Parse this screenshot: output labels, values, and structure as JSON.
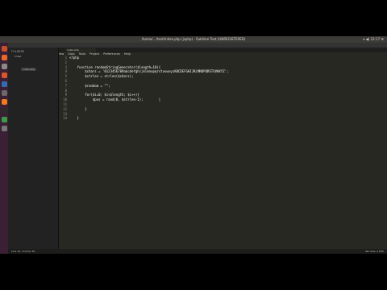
{
  "window": {
    "title": "/home/…/test/index.php (jsphp) - Sublime Text (UNREGISTERED)"
  },
  "tray": {
    "text": "▾ ◀) 12:17 ⚙"
  },
  "menu": [
    "File",
    "Edit",
    "Selection",
    "Find",
    "View",
    "Goto",
    "Tools",
    "Project",
    "Preferences",
    "Help"
  ],
  "sidebar": {
    "header": "FOLDERS",
    "folder": "▾ test",
    "file": "index.php"
  },
  "tab": {
    "label": "index.php"
  },
  "code_lines": [
    {
      "n": "1",
      "text": "<?php"
    },
    {
      "n": "2",
      "text": ""
    },
    {
      "n": "3",
      "text": "    function randomStringGenerator($length=10){"
    },
    {
      "n": "4",
      "text": "        $chars = '0123456789abcdefghijklmnopqrstuvwxyzABCDEFGHIJKLMNOPQRSTUVWXYZ';"
    },
    {
      "n": "5",
      "text": "        $strlen = strlen($chars);"
    },
    {
      "n": "6",
      "text": ""
    },
    {
      "n": "7",
      "text": "        $random = \"\";"
    },
    {
      "n": "8",
      "text": ""
    },
    {
      "n": "9",
      "text": "        for($i=0; $i<$length; $i++){"
    },
    {
      "n": "10",
      "text": "            $pos = rand(0, $strlen-1);        |"
    },
    {
      "n": "11",
      "text": ""
    },
    {
      "n": "12",
      "text": "        }"
    },
    {
      "n": "13",
      "text": ""
    },
    {
      "n": "14",
      "text": "    }"
    }
  ],
  "status": {
    "left": "Line 10, Column 38",
    "right": "Tab Size: 4    PHP"
  },
  "colors": {
    "editor_bg": "#272822",
    "launcher": "#3b2035"
  },
  "launcher_icons": [
    "dash-icon",
    "firefox-icon",
    "files-icon",
    "software-icon",
    "libreoffice-icon",
    "settings-icon",
    "sublime-icon",
    "terminal-icon",
    "chrome-icon",
    "trash-icon"
  ]
}
